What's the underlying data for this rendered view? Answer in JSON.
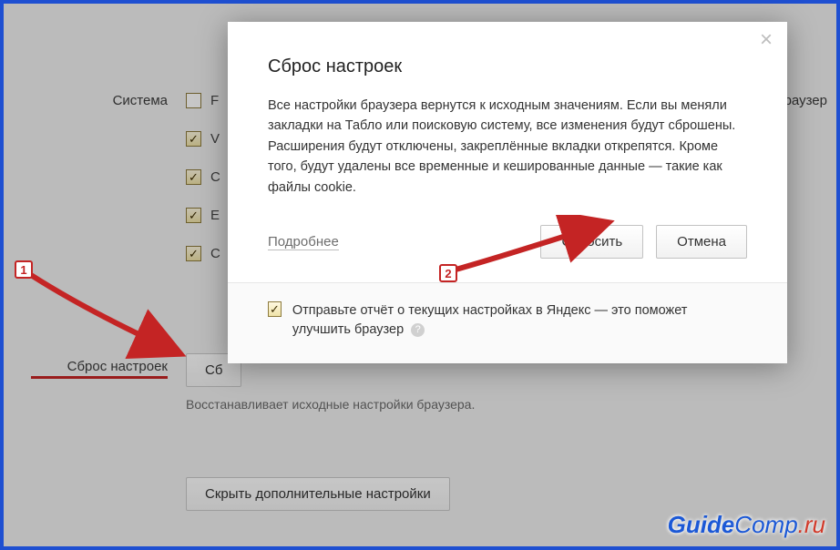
{
  "settings": {
    "system_label": "Система",
    "reset_label": "Сброс настроек",
    "rows": {
      "r1": "F",
      "r2": "V",
      "r3": "C",
      "r4": "E",
      "r5": "C"
    },
    "right_cut": "раузер",
    "reset_button_text": "Сб",
    "reset_desc": "Восстанавливает исходные настройки браузера.",
    "hide_button": "Скрыть дополнительные настройки"
  },
  "modal": {
    "title": "Сброс настроек",
    "text": "Все настройки браузера вернутся к исходным значениям. Если вы меняли закладки на Табло или поисковую систему, все изменения будут сброшены. Расширения будут отключены, закреплённые вкладки открепятся. Кроме того, будут удалены все временные и кешированные данные — такие как файлы cookie.",
    "more": "Подробнее",
    "confirm": "Сбросить",
    "cancel": "Отмена",
    "report_label": "Отправьте отчёт о текущих настройках в Яндекс — это поможет улучшить браузер"
  },
  "annotation": {
    "n1": "1",
    "n2": "2"
  },
  "watermark": {
    "a": "Guide",
    "b": "Comp",
    "c": ".ru"
  }
}
